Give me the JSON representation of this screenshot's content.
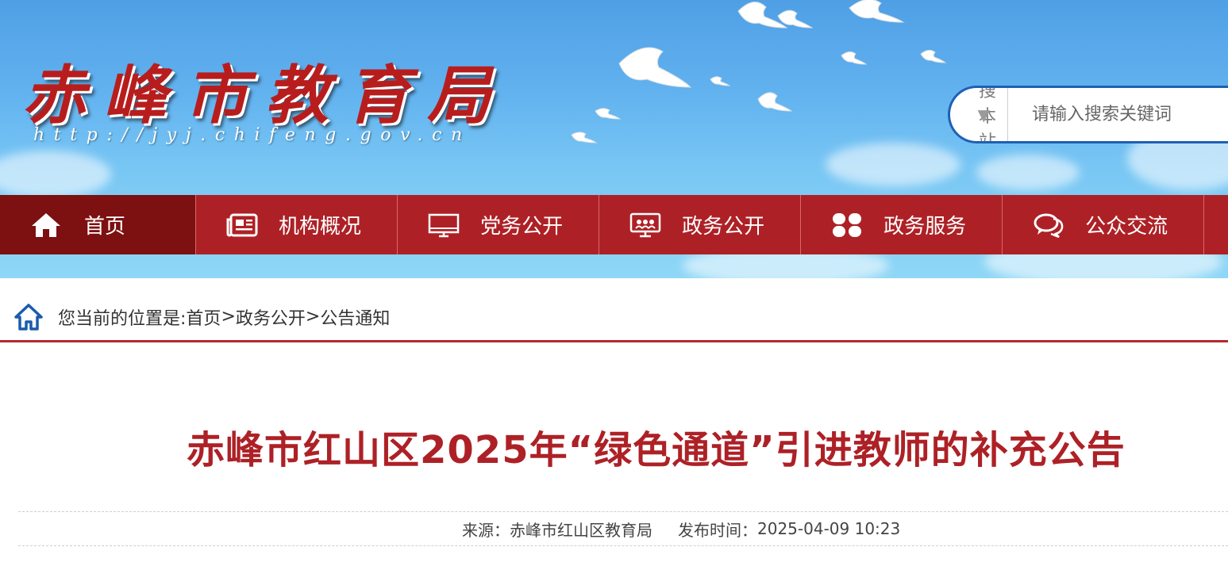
{
  "header": {
    "site_title": "赤峰市教育局",
    "site_url": "http://jyj.chifeng.gov.cn"
  },
  "search": {
    "scope_label": "搜本站",
    "scope_caret": "▼",
    "placeholder": "请输入搜索关键词"
  },
  "nav": {
    "items": [
      {
        "label": "首页",
        "icon": "home-icon"
      },
      {
        "label": "机构概况",
        "icon": "newspaper-icon"
      },
      {
        "label": "党务公开",
        "icon": "monitor-icon"
      },
      {
        "label": "政务公开",
        "icon": "presentation-icon"
      },
      {
        "label": "政务服务",
        "icon": "grid-icon"
      },
      {
        "label": "公众交流",
        "icon": "chat-icon"
      }
    ]
  },
  "breadcrumb": {
    "prefix": "您当前的位置是:",
    "items": [
      "首页",
      "政务公开",
      "公告通知"
    ],
    "separator": ">"
  },
  "article": {
    "title": "赤峰市红山区2025年“绿色通道”引进教师的补充公告",
    "source_label": "来源：",
    "source_value": "赤峰市红山区教育局",
    "time_label": "发布时间：",
    "time_value": "2025-04-09 10:23"
  },
  "colors": {
    "nav_bg": "#ad2126",
    "nav_active": "#7d1010",
    "title": "#ad2126",
    "search_border": "#1f5fb4"
  }
}
